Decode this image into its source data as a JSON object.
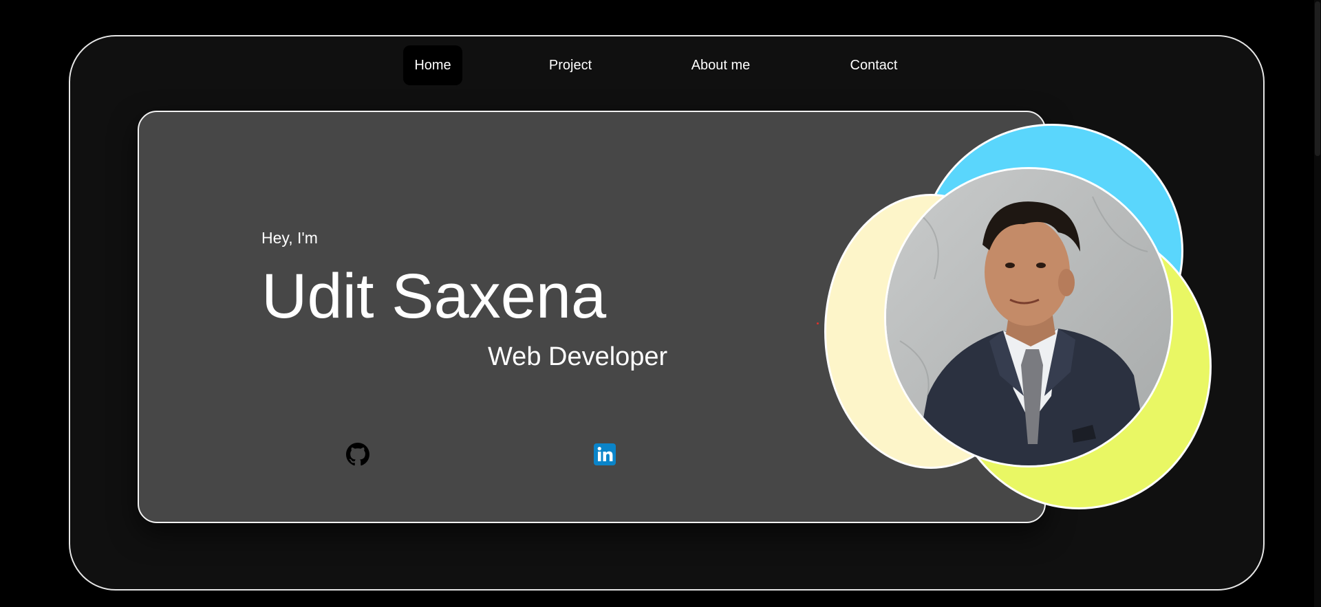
{
  "nav": {
    "items": [
      {
        "label": "Home",
        "active": true
      },
      {
        "label": "Project",
        "active": false
      },
      {
        "label": "About me",
        "active": false
      },
      {
        "label": "Contact",
        "active": false
      }
    ]
  },
  "hero": {
    "greeting": "Hey, I'm",
    "name": "Udit Saxena",
    "role": "Web Developer"
  },
  "social": {
    "github_icon": "github-icon",
    "linkedin_icon": "linkedin-icon",
    "linkedin_color": "#0a84c9"
  },
  "colors": {
    "page_background": "#000000",
    "frame_background": "#101010",
    "card_background": "#474747",
    "accent_blue": "#5ad6fc",
    "accent_cream": "#fdf5c9",
    "accent_lime": "#e9f764",
    "marker_red": "#e0302a"
  },
  "profile": {
    "photo_icon": "profile-photo"
  }
}
